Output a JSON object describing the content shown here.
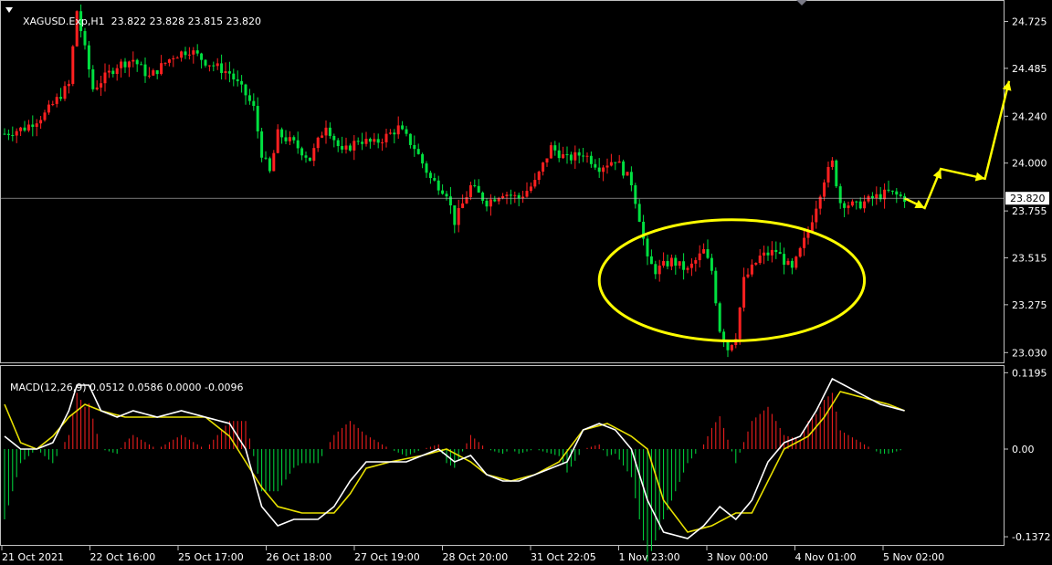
{
  "header": {
    "symbol": "XAGUSD.Exp,H1",
    "ohlc": "23.822 23.828 23.815 23.820"
  },
  "macd_header": {
    "label": "MACD(12,26,9)",
    "values": "0.0512 0.0586 0.0000 -0.0096"
  },
  "colors": {
    "background": "#000000",
    "bull": "#ff2020",
    "bear": "#00e040",
    "macd_line": "#ffffff",
    "signal_line": "#e8e000",
    "annotation": "#ffff00",
    "current_price_line": "#c0c0c0"
  },
  "chart_data": [
    {
      "type": "candlestick",
      "symbol": "XAGUSD.Exp",
      "timeframe": "H1",
      "current_price": 23.82,
      "ylim": [
        22.98,
        24.83
      ],
      "price_ticks": [
        "24.725",
        "24.485",
        "24.240",
        "24.000",
        "23.755",
        "23.515",
        "23.275",
        "23.030"
      ],
      "x_labels": [
        "21 Oct 2021",
        "22 Oct 16:00",
        "25 Oct 17:00",
        "26 Oct 18:00",
        "27 Oct 19:00",
        "28 Oct 20:00",
        "31 Oct 22:05",
        "1 Nov 23:00",
        "3 Nov 00:00",
        "4 Nov 01:00",
        "5 Nov 02:00"
      ],
      "close_path": [
        [
          0,
          24.15
        ],
        [
          5,
          24.18
        ],
        [
          10,
          24.25
        ],
        [
          16,
          24.4
        ],
        [
          18,
          24.78
        ],
        [
          22,
          24.38
        ],
        [
          28,
          24.5
        ],
        [
          32,
          24.53
        ],
        [
          36,
          24.44
        ],
        [
          42,
          24.55
        ],
        [
          46,
          24.58
        ],
        [
          50,
          24.52
        ],
        [
          56,
          24.46
        ],
        [
          60,
          24.35
        ],
        [
          62,
          24.28
        ],
        [
          64,
          24.05
        ],
        [
          66,
          23.95
        ],
        [
          68,
          24.15
        ],
        [
          72,
          24.1
        ],
        [
          76,
          24.02
        ],
        [
          80,
          24.2
        ],
        [
          84,
          24.05
        ],
        [
          88,
          24.12
        ],
        [
          92,
          24.1
        ],
        [
          96,
          24.15
        ],
        [
          98,
          24.18
        ],
        [
          102,
          24.08
        ],
        [
          106,
          23.92
        ],
        [
          110,
          23.85
        ],
        [
          112,
          23.7
        ],
        [
          116,
          23.88
        ],
        [
          120,
          23.8
        ],
        [
          124,
          23.85
        ],
        [
          128,
          23.82
        ],
        [
          132,
          23.9
        ],
        [
          136,
          24.08
        ],
        [
          140,
          24.02
        ],
        [
          144,
          24.05
        ],
        [
          148,
          23.98
        ],
        [
          152,
          24.02
        ],
        [
          156,
          23.9
        ],
        [
          158,
          23.72
        ],
        [
          160,
          23.5
        ],
        [
          162,
          23.45
        ],
        [
          166,
          23.5
        ],
        [
          170,
          23.45
        ],
        [
          174,
          23.55
        ],
        [
          176,
          23.45
        ],
        [
          178,
          23.15
        ],
        [
          180,
          23.05
        ],
        [
          182,
          23.12
        ],
        [
          184,
          23.4
        ],
        [
          188,
          23.52
        ],
        [
          192,
          23.55
        ],
        [
          196,
          23.45
        ],
        [
          200,
          23.65
        ],
        [
          204,
          23.92
        ],
        [
          206,
          24.0
        ],
        [
          208,
          23.8
        ],
        [
          212,
          23.78
        ],
        [
          216,
          23.82
        ],
        [
          220,
          23.85
        ],
        [
          224,
          23.82
        ]
      ],
      "annotations": [
        {
          "type": "ellipse",
          "color": "#ffff00",
          "center_x_index": 181,
          "center_y": 23.4,
          "half_width_bars": 33,
          "half_height_price": 0.31
        },
        {
          "type": "projection_path",
          "color": "#ffff00",
          "points": [
            [
              224,
              23.82
            ],
            [
              229,
              23.77
            ],
            [
              233,
              23.97
            ],
            [
              244,
              23.92
            ],
            [
              250,
              24.42
            ]
          ]
        }
      ]
    },
    {
      "type": "macd",
      "label": "MACD(12,26,9)",
      "params": [
        12,
        26,
        9
      ],
      "readout": {
        "macd": 0.0512,
        "signal": 0.0586,
        "histogram": 0.0,
        "extra": -0.0096
      },
      "ylim": [
        -0.15,
        0.13
      ],
      "y_ticks": [
        "0.1195",
        "0.00",
        "-0.1372"
      ],
      "macd_path": [
        [
          0,
          0.02
        ],
        [
          4,
          0.0
        ],
        [
          8,
          0.0
        ],
        [
          12,
          0.01
        ],
        [
          16,
          0.06
        ],
        [
          18,
          0.1
        ],
        [
          21,
          0.1
        ],
        [
          24,
          0.06
        ],
        [
          28,
          0.05
        ],
        [
          32,
          0.06
        ],
        [
          38,
          0.05
        ],
        [
          44,
          0.06
        ],
        [
          50,
          0.05
        ],
        [
          56,
          0.04
        ],
        [
          60,
          0.0
        ],
        [
          64,
          -0.09
        ],
        [
          68,
          -0.12
        ],
        [
          72,
          -0.11
        ],
        [
          78,
          -0.11
        ],
        [
          82,
          -0.09
        ],
        [
          86,
          -0.05
        ],
        [
          90,
          -0.02
        ],
        [
          96,
          -0.02
        ],
        [
          100,
          -0.02
        ],
        [
          104,
          -0.01
        ],
        [
          108,
          0.0
        ],
        [
          112,
          -0.02
        ],
        [
          116,
          -0.01
        ],
        [
          120,
          -0.04
        ],
        [
          124,
          -0.05
        ],
        [
          128,
          -0.05
        ],
        [
          132,
          -0.04
        ],
        [
          136,
          -0.03
        ],
        [
          140,
          -0.02
        ],
        [
          144,
          0.03
        ],
        [
          148,
          0.04
        ],
        [
          152,
          0.03
        ],
        [
          156,
          0.0
        ],
        [
          160,
          -0.08
        ],
        [
          164,
          -0.13
        ],
        [
          170,
          -0.14
        ],
        [
          174,
          -0.12
        ],
        [
          178,
          -0.09
        ],
        [
          182,
          -0.11
        ],
        [
          186,
          -0.08
        ],
        [
          190,
          -0.02
        ],
        [
          194,
          0.01
        ],
        [
          198,
          0.02
        ],
        [
          202,
          0.06
        ],
        [
          206,
          0.11
        ],
        [
          212,
          0.09
        ],
        [
          218,
          0.07
        ],
        [
          224,
          0.06
        ]
      ],
      "signal_path": [
        [
          0,
          0.07
        ],
        [
          4,
          0.01
        ],
        [
          8,
          0.0
        ],
        [
          12,
          0.02
        ],
        [
          16,
          0.05
        ],
        [
          20,
          0.07
        ],
        [
          24,
          0.06
        ],
        [
          30,
          0.05
        ],
        [
          36,
          0.05
        ],
        [
          44,
          0.05
        ],
        [
          50,
          0.05
        ],
        [
          56,
          0.02
        ],
        [
          60,
          -0.02
        ],
        [
          64,
          -0.06
        ],
        [
          68,
          -0.09
        ],
        [
          74,
          -0.1
        ],
        [
          82,
          -0.1
        ],
        [
          86,
          -0.07
        ],
        [
          90,
          -0.03
        ],
        [
          96,
          -0.02
        ],
        [
          104,
          -0.01
        ],
        [
          110,
          0.0
        ],
        [
          116,
          -0.02
        ],
        [
          120,
          -0.04
        ],
        [
          126,
          -0.05
        ],
        [
          132,
          -0.04
        ],
        [
          138,
          -0.02
        ],
        [
          144,
          0.03
        ],
        [
          150,
          0.04
        ],
        [
          156,
          0.02
        ],
        [
          160,
          0.0
        ],
        [
          164,
          -0.08
        ],
        [
          170,
          -0.13
        ],
        [
          176,
          -0.12
        ],
        [
          182,
          -0.1
        ],
        [
          186,
          -0.1
        ],
        [
          190,
          -0.05
        ],
        [
          194,
          0.0
        ],
        [
          200,
          0.02
        ],
        [
          204,
          0.05
        ],
        [
          208,
          0.09
        ],
        [
          214,
          0.08
        ],
        [
          220,
          0.07
        ],
        [
          224,
          0.06
        ]
      ]
    }
  ]
}
